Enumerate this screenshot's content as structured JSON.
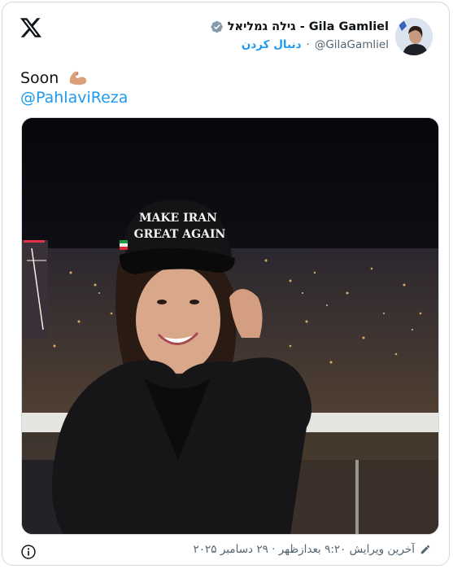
{
  "tweet": {
    "display_name": "גילה גמליאל - Gila Gamliel",
    "handle": "@GilaGamliel",
    "follow_label": "دنبال کردن",
    "separator": "·",
    "text": "Soon",
    "mention": "@PahlaviReza",
    "photo": {
      "cap_text_line1": "MAKE IRAN",
      "cap_text_line2": "GREAT AGAIN"
    },
    "edited_label": "آخرین ویرایش ۹:۲۰ بعدازظهر · ۲۹ دسامبر ۲۰۲۵"
  },
  "icons": {
    "logo": "x-logo-icon",
    "verified": "verified-badge-icon",
    "emoji": "flexed-biceps-emoji",
    "info": "info-icon",
    "edit": "pencil-icon"
  },
  "colors": {
    "accent": "#1d9bf0",
    "text": "#0f1419",
    "muted": "#536471",
    "border": "#cfd9de",
    "verified_badge": "#829aab"
  }
}
